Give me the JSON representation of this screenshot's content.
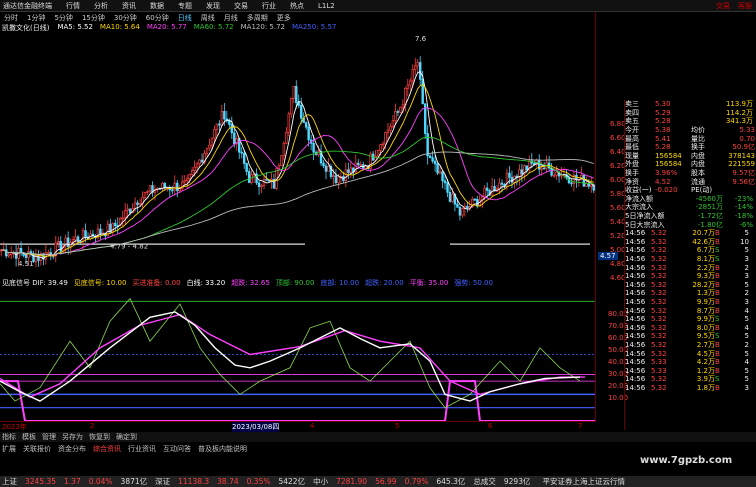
{
  "menubar": {
    "logo": "通达信金融终端",
    "items": [
      "行情",
      "分析",
      "资讯",
      "数据",
      "专题",
      "发现",
      "交易",
      "行业",
      "热点",
      "L1L2"
    ],
    "right": [
      "交易",
      "客服"
    ]
  },
  "periods": [
    "分时",
    "1分钟",
    "5分钟",
    "15分钟",
    "30分钟",
    "60分钟",
    "日线",
    "周线",
    "月线",
    "多周期",
    "更多"
  ],
  "stock_title": "凯撒文化(日线)",
  "ma_legend": [
    {
      "label": "MA5: 5.52",
      "color": "#ffffff"
    },
    {
      "label": "MA10: 5.64",
      "color": "#ffd800"
    },
    {
      "label": "MA20: 5.77",
      "color": "#ff40ff"
    },
    {
      "label": "MA60: 5.72",
      "color": "#2fc52f"
    },
    {
      "label": "MA120: 5.72",
      "color": "#bbbbbb"
    },
    {
      "label": "MA250: 5.57",
      "color": "#4060ff"
    }
  ],
  "price_annotations": {
    "high": "7.6",
    "low1": "4.79 - 4.82",
    "low2": "4.51"
  },
  "indicator_legend": [
    {
      "label": "见底信号 DIF: 39.49",
      "color": "#eeeeee"
    },
    {
      "label": "见底信号: 10.00",
      "color": "#ffd800"
    },
    {
      "label": "买进准备: 0.00",
      "color": "#ff4040"
    },
    {
      "label": "白线: 33.20",
      "color": "#ffffff"
    },
    {
      "label": "超跌: 32.65",
      "color": "#ff40ff"
    },
    {
      "label": "顶部: 90.00",
      "color": "#2fc52f"
    },
    {
      "label": "底部: 10.00",
      "color": "#4060ff"
    },
    {
      "label": "超跌: 20.00",
      "color": "#4060ff"
    },
    {
      "label": "平衡: 35.00",
      "color": "#ff40ff"
    },
    {
      "label": "强势: 50.00",
      "color": "#4060ff"
    }
  ],
  "indicator_axis": [
    "80.00",
    "70.00",
    "60.00",
    "50.00",
    "40.00",
    "30.00",
    "20.00",
    "10.00"
  ],
  "price_axis": [
    "6.80",
    "6.60",
    "6.40",
    "6.20",
    "6.00",
    "5.80",
    "5.60",
    "5.40",
    "5.20",
    "5.00",
    "4.80",
    "4.60"
  ],
  "dates": [
    "2022年",
    "2",
    "2023/03/08四",
    "4",
    "5",
    "6",
    "7"
  ],
  "quote": {
    "asks": [
      [
        "卖三",
        "5.30",
        "113.9万"
      ],
      [
        "卖四",
        "5.29",
        "114.2万"
      ],
      [
        "卖五",
        "5.28",
        "341.3万"
      ]
    ],
    "stats": [
      [
        "今开",
        "5.38",
        "均价",
        "5.33"
      ],
      [
        "最高",
        "5.41",
        "量比",
        "0.70"
      ],
      [
        "最低",
        "5.28",
        "换手",
        "50.9亿"
      ],
      [
        "现量",
        "156584",
        "内盘",
        "378143"
      ],
      [
        "外盘",
        "156584",
        "内盘",
        "221559"
      ],
      [
        "换手",
        "3.96%",
        "股本",
        "9.57亿"
      ],
      [
        "净资",
        "4.52",
        "流通",
        "9.56亿"
      ],
      [
        "收益(一)",
        "-0.020",
        "PE(动)",
        ""
      ]
    ],
    "flows": [
      [
        "净流入额",
        "-4560万",
        "-23%"
      ],
      [
        "大宗流入",
        "-2851万",
        "-14%"
      ],
      [
        "5日净流入额",
        "-1.72亿",
        "-18%"
      ],
      [
        "5日大宗流入",
        "-1.80亿",
        "-6%"
      ]
    ],
    "current_price": "4.57",
    "ticks": [
      [
        "14:56",
        "5.32",
        "20.7万",
        "B",
        "5"
      ],
      [
        "14:56",
        "5.32",
        "42.6万",
        "B",
        "10"
      ],
      [
        "14:56",
        "5.32",
        "6.7万",
        "S",
        "5"
      ],
      [
        "14:56",
        "5.32",
        "8.1万",
        "S",
        "3"
      ],
      [
        "14:56",
        "5.32",
        "2.2万",
        "B",
        "2"
      ],
      [
        "14:56",
        "5.32",
        "9.3万",
        "B",
        "3"
      ],
      [
        "14:56",
        "5.32",
        "28.2万",
        "B",
        "5"
      ],
      [
        "14:56",
        "5.32",
        "1.3万",
        "B",
        "2"
      ],
      [
        "14:56",
        "5.32",
        "9.9万",
        "B",
        "3"
      ],
      [
        "14:56",
        "5.32",
        "8.7万",
        "B",
        "4"
      ],
      [
        "14:56",
        "5.32",
        "9.9万",
        "S",
        "5"
      ],
      [
        "14:56",
        "5.32",
        "8.0万",
        "B",
        "4"
      ],
      [
        "14:56",
        "5.32",
        "9.5万",
        "S",
        "5"
      ],
      [
        "14:56",
        "5.32",
        "2.7万",
        "B",
        "2"
      ],
      [
        "14:56",
        "5.32",
        "4.5万",
        "B",
        "5"
      ],
      [
        "14:56",
        "5.33",
        "4.2万",
        "B",
        "4"
      ],
      [
        "14:56",
        "5.33",
        "1.2万",
        "B",
        "5"
      ],
      [
        "14:56",
        "5.32",
        "3.9万",
        "S",
        "5"
      ],
      [
        "14:56",
        "5.32",
        "1.8万",
        "B",
        "3"
      ]
    ]
  },
  "bottom_tabs": [
    "指标",
    "模板",
    "管理",
    "另存为",
    "恢复到",
    "确定到"
  ],
  "bottom_tabs2": [
    "扩展",
    "关联报价",
    "资金分布",
    "综合资讯",
    "行业资讯",
    "互动问答",
    "普及板内能说明"
  ],
  "status": [
    {
      "label": "上证",
      "v": "3245.35",
      "c": "1.37",
      "p": "0.04%",
      "amt": "3871亿"
    },
    {
      "label": "深证",
      "v": "11138.3",
      "c": "38.74",
      "p": "0.35%",
      "amt": "5422亿"
    },
    {
      "label": "中小",
      "v": "7281.90",
      "c": "56.99",
      "p": "0.79%",
      "amt": "645.3亿"
    },
    {
      "label": "总成交",
      "v": "9293亿",
      "c": "",
      "p": "",
      "amt": ""
    }
  ],
  "status_right": "平安证券上海上证云行情",
  "watermark": "www.7gpzb.com",
  "colors": {
    "up": "#ff4040",
    "down": "#4fd8ff",
    "ma5": "#ffffff",
    "ma10": "#ffd800",
    "ma20": "#ff40ff",
    "ma60": "#2fc52f",
    "ma120": "#bbbbbb"
  }
}
